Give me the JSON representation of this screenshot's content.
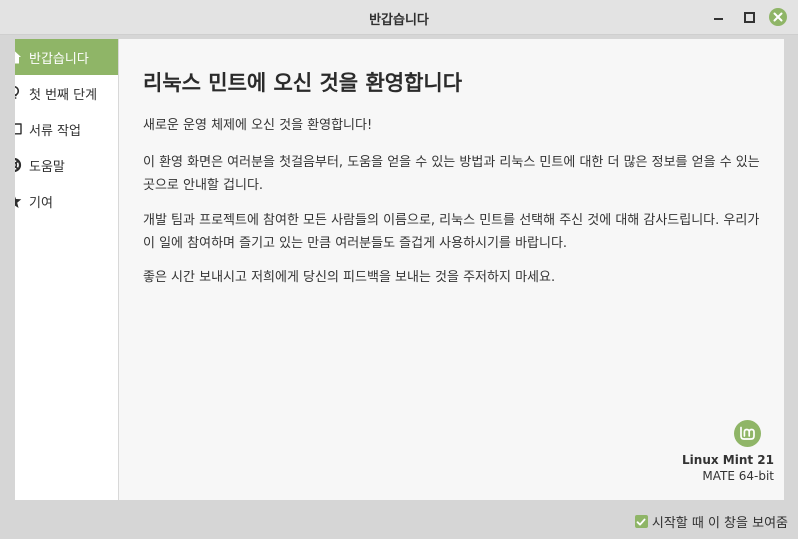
{
  "window": {
    "title": "반갑습니다"
  },
  "colors": {
    "accent": "#8fb567",
    "window_bg": "#d6d6d6",
    "content_bg": "#f7f7f7"
  },
  "sidebar": {
    "items": [
      {
        "label": "반갑습니다",
        "icon": "home-icon",
        "active": true
      },
      {
        "label": "첫 번째 단계",
        "icon": "lightbulb-icon",
        "active": false
      },
      {
        "label": "서류 작업",
        "icon": "book-icon",
        "active": false
      },
      {
        "label": "도움말",
        "icon": "lifebuoy-icon",
        "active": false
      },
      {
        "label": "기여",
        "icon": "star-icon",
        "active": false
      }
    ]
  },
  "main": {
    "heading": "리눅스 민트에 오신 것을 환영합니다",
    "paragraphs": [
      "새로운 운영 체제에 오신 것을 환영합니다!",
      "이 환영 화면은 여러분을 첫걸음부터, 도움을 얻을 수 있는 방법과 리눅스 민트에 대한 더 많은 정보를 얻을 수 있는 곳으로 안내할 겁니다.",
      "개발 팀과 프로젝트에 참여한 모든 사람들의 이름으로, 리눅스 민트를 선택해 주신 것에 대해 감사드립니다. 우리가 이 일에 참여하며 즐기고 있는 만큼 여러분들도 즐겁게 사용하시기를 바랍니다.",
      "좋은 시간 보내시고 저희에게 당신의 피드백을 보내는 것을 주저하지 마세요."
    ],
    "distro": "Linux Mint 21",
    "edition": "MATE 64-bit"
  },
  "footer": {
    "checkbox_label": "시작할 때 이 창을 보여줌",
    "checked": true
  }
}
